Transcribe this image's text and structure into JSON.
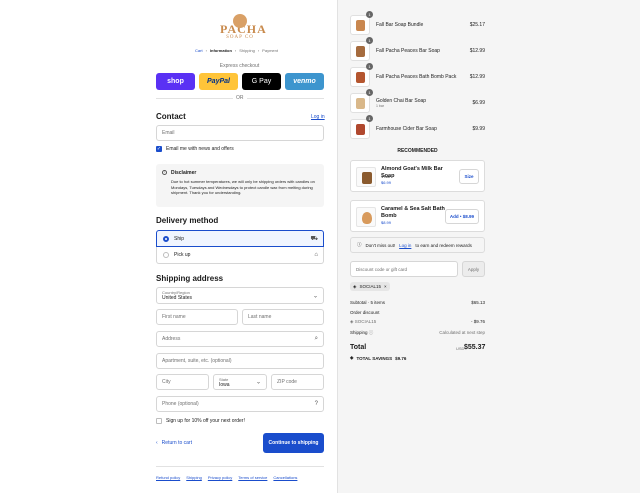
{
  "brand": {
    "name": "PACHA",
    "sub": "SOAP CO"
  },
  "breadcrumb": [
    "Cart",
    "Information",
    "Shipping",
    "Payment"
  ],
  "express": {
    "label": "Express checkout",
    "buttons": [
      "shop",
      "PayPal",
      "G Pay",
      "venmo"
    ],
    "or": "OR"
  },
  "contact": {
    "title": "Contact",
    "login": "Log in",
    "email_placeholder": "Email",
    "news": "Email me with news and offers"
  },
  "disclaimer": {
    "title": "Disclaimer",
    "body": "Due to hot summer temperatures, we will only be shipping orders with candles on Mondays, Tuesdays and Wednesdays to protect candle wax from melting during shipment. Thank you for understanding."
  },
  "delivery": {
    "title": "Delivery method",
    "ship": "Ship",
    "pickup": "Pick up"
  },
  "shipping": {
    "title": "Shipping address",
    "country_label": "Country/Region",
    "country": "United States",
    "first": "First name",
    "last": "Last name",
    "address": "Address",
    "apt": "Apartment, suite, etc. (optional)",
    "city": "City",
    "state_label": "State",
    "state": "Iowa",
    "zip": "ZIP code",
    "phone": "Phone (optional)",
    "signup": "Sign up for 10% off your next order!"
  },
  "nav": {
    "back": "Return to cart",
    "continue": "Continue to shipping"
  },
  "footer": [
    "Refund policy",
    "Shipping",
    "Privacy policy",
    "Terms of service",
    "Cancellations"
  ],
  "cart": {
    "items": [
      {
        "qty": "1",
        "name": "Fall Bar Soap Bundle",
        "sub": "",
        "price": "$25.17",
        "color": "#c9874f"
      },
      {
        "qty": "1",
        "name": "Fall Pacha Peaces Bar Soap",
        "sub": "",
        "price": "$12.99",
        "color": "#a56b3e"
      },
      {
        "qty": "1",
        "name": "Fall Pacha Peaces Bath Bomb Pack",
        "sub": "",
        "price": "$12.99",
        "color": "#b5562f"
      },
      {
        "qty": "1",
        "name": "Golden Chai Bar Soap",
        "sub": "1 bar",
        "price": "$6.99",
        "color": "#d9b88a"
      },
      {
        "qty": "1",
        "name": "Farmhouse Cider Bar Soap",
        "sub": "",
        "price": "$9.99",
        "color": "#b0482e"
      }
    ],
    "recommended_title": "RECOMMENDED",
    "recommended": [
      {
        "name": "Almond Goat's Milk Bar Soap",
        "sub": "1 bar",
        "price": "$6.99",
        "button": "Size",
        "color": "#8a5a2e"
      },
      {
        "name": "Caramel & Sea Salt Bath Bomb",
        "sub": "",
        "price": "$8.99",
        "button": "Add • $8.99",
        "color": "#d89a5c"
      }
    ],
    "reward": {
      "pre": "Don't miss out!",
      "link": "Log in",
      "post": "to earn and redeem rewards"
    },
    "discount_placeholder": "Discount code or gift card",
    "apply": "Apply",
    "code": "SOCIAL15",
    "subtotal_label": "Subtotal · 5 items",
    "subtotal": "$65.13",
    "order_discount": "Order discount",
    "code_line": "SOCIAL15",
    "discount_value": "- $9.76",
    "shipping_label": "Shipping",
    "shipping_value": "Calculated at next step",
    "total_label": "Total",
    "currency": "USD",
    "total": "$55.37",
    "savings_label": "TOTAL SAVINGS",
    "savings": "$9.76"
  }
}
